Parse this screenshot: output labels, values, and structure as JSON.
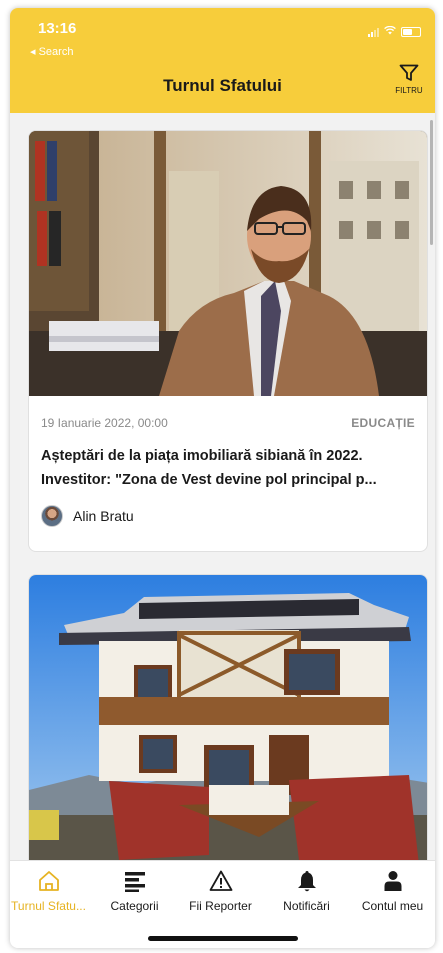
{
  "status_bar": {
    "time": "13:16",
    "back_label": "◂ Search"
  },
  "header": {
    "title": "Turnul Sfatului",
    "filter_label": "FILTRU"
  },
  "articles": [
    {
      "date": "19 Ianuarie 2022, 00:00",
      "category": "EDUCAȚIE",
      "title_line1": "Așteptări de la piața imobiliară sibiană în 2022.",
      "title_line2": "Investitor: \"Zona de Vest devine pol principal p...",
      "author": "Alin Bratu"
    },
    {
      "date": "",
      "category": "",
      "title_line1": "",
      "title_line2": "",
      "author": ""
    }
  ],
  "tabs": [
    {
      "label": "Turnul Sfatu...",
      "icon": "home-icon",
      "active": true
    },
    {
      "label": "Categorii",
      "icon": "list-icon",
      "active": false
    },
    {
      "label": "Fii Reporter",
      "icon": "warning-icon",
      "active": false
    },
    {
      "label": "Notificări",
      "icon": "bell-icon",
      "active": false
    },
    {
      "label": "Contul meu",
      "icon": "user-icon",
      "active": false
    }
  ],
  "colors": {
    "accent": "#f7cd3b",
    "active_tab": "#e6b322",
    "background": "#f2f2f2"
  }
}
